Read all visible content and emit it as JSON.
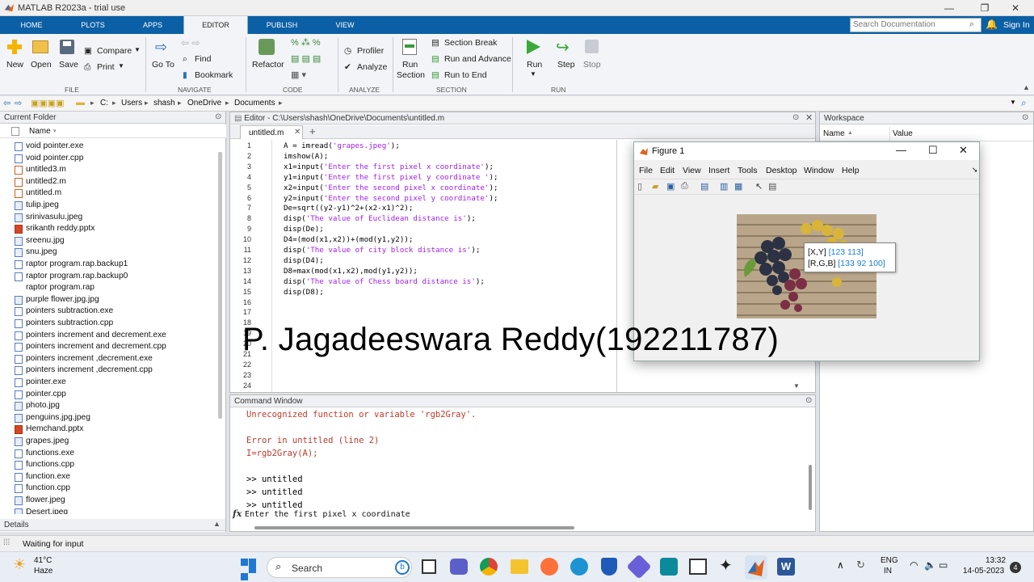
{
  "titlebar": {
    "title": "MATLAB R2023a - trial use"
  },
  "ribbon_tabs": [
    "HOME",
    "PLOTS",
    "APPS",
    "EDITOR",
    "PUBLISH",
    "VIEW"
  ],
  "search": {
    "placeholder": "Search Documentation"
  },
  "signin": "Sign In",
  "ribbon": {
    "new": "New",
    "open": "Open",
    "save": "Save",
    "compare": "Compare",
    "print": "Print",
    "goto_l1": "Go To",
    "find": "Find",
    "bookmark": "Bookmark",
    "refactor": "Refactor",
    "profiler": "Profiler",
    "analyze": "Analyze",
    "run_section_l1": "Run",
    "run_section_l2": "Section",
    "section_break": "Section Break",
    "run_and_advance": "Run and Advance",
    "run_to_end": "Run to End",
    "run": "Run",
    "step": "Step",
    "stop": "Stop",
    "groups": {
      "file": "FILE",
      "navigate": "NAVIGATE",
      "code": "CODE",
      "analyze": "ANALYZE",
      "section": "SECTION",
      "run": "RUN"
    }
  },
  "address": {
    "crumbs": [
      "C:",
      "Users",
      "shash",
      "OneDrive",
      "Documents"
    ]
  },
  "current_folder": {
    "title": "Current Folder",
    "col_name": "Name",
    "files": [
      "void pointer.exe",
      "void pointer.cpp",
      "untitled3.m",
      "untitled2.m",
      "untitled.m",
      "tulip.jpeg",
      "srinivasulu.jpeg",
      "srikanth reddy.pptx",
      "sreenu.jpg",
      "snu.jpeg",
      "raptor program.rap.backup1",
      "raptor program.rap.backup0",
      "raptor program.rap",
      "purple flower.jpg.jpg",
      "pointers subtraction.exe",
      "pointers subtraction.cpp",
      "pointers increment and decrement.exe",
      "pointers increment and decrement.cpp",
      "pointers increment ,decrement.exe",
      "pointers increment ,decrement.cpp",
      "pointer.exe",
      "pointer.cpp",
      "photo.jpg",
      "penguins.jpg.jpeg",
      "Hemchand.pptx",
      "grapes.jpeg",
      "functions.exe",
      "functions.cpp",
      "function.exe",
      "function.cpp",
      "flower.jpeg",
      "Desert.jpeg"
    ],
    "details": "Details"
  },
  "editor": {
    "title": "Editor - C:\\Users\\shash\\OneDrive\\Documents\\untitled.m",
    "tab": "untitled.m",
    "code": [
      "A = imread('grapes.jpeg');",
      "imshow(A);",
      "x1=input('Enter the first pixel x coordinate');",
      "y1=input('Enter the first pixel y coordinate ');",
      "x2=input('Enter the second pixel x coordinate');",
      "y2=input('Enter the second pixel y coordinate');",
      "De=sqrt((y2-y1)^2+(x2-x1)^2);",
      "disp('The value of Euclidean distance is');",
      "disp(De);",
      "D4=(mod(x1,x2))+(mod(y1,y2));",
      "disp('The value of city block distance is');",
      "disp(D4);",
      "D8=max(mod(x1,x2),mod(y1,y2));",
      "disp('The value of Chess board distance is');",
      "disp(D8);"
    ],
    "line_numbers": [
      "1",
      "2",
      "3",
      "4",
      "5",
      "6",
      "7",
      "8",
      "9",
      "10",
      "11",
      "12",
      "13",
      "14",
      "15",
      "16",
      "17",
      "18",
      "19",
      "20",
      "21",
      "22",
      "23",
      "24"
    ]
  },
  "overlay_text": "P. Jagadeeswara Reddy(192211787)",
  "command_window": {
    "title": "Command Window",
    "lines": [
      {
        "t": "Unrecognized function or variable 'rgb2Gray'.",
        "c": "#c0392b"
      },
      {
        "t": "",
        "c": "#000"
      },
      {
        "t": "Error in untitled (line 2)",
        "c": "#c0392b"
      },
      {
        "t": "I=rgb2Gray(A);",
        "c": "#c0392b"
      },
      {
        "t": "",
        "c": "#000"
      },
      {
        "t": ">> untitled",
        "c": "#000"
      },
      {
        "t": ">> untitled",
        "c": "#000"
      },
      {
        "t": ">> untitled",
        "c": "#000"
      }
    ],
    "prompt": "Enter the first pixel x coordinate",
    "fx": "fx"
  },
  "workspace": {
    "title": "Workspace",
    "col_name": "Name",
    "col_value": "Value"
  },
  "figure": {
    "title": "Figure 1",
    "menu": [
      "File",
      "Edit",
      "View",
      "Insert",
      "Tools",
      "Desktop",
      "Window",
      "Help"
    ],
    "datatip_xy_label": "[X,Y]",
    "datatip_xy_value": "[123 113]",
    "datatip_rgb_label": "[R,G,B]",
    "datatip_rgb_value": "[133 92 100]"
  },
  "status": "Waiting for input",
  "taskbar": {
    "weather_temp": "41°C",
    "weather_desc": "Haze",
    "search": "Search",
    "lang1": "ENG",
    "lang2": "IN",
    "time": "13:32",
    "date": "14-05-2023",
    "notif": "4"
  },
  "colors": {
    "ribbon_blue": "#0b5fa5",
    "string_purple": "#a020f0",
    "error_red": "#c0392b",
    "datatip_blue": "#1a7fd6"
  }
}
